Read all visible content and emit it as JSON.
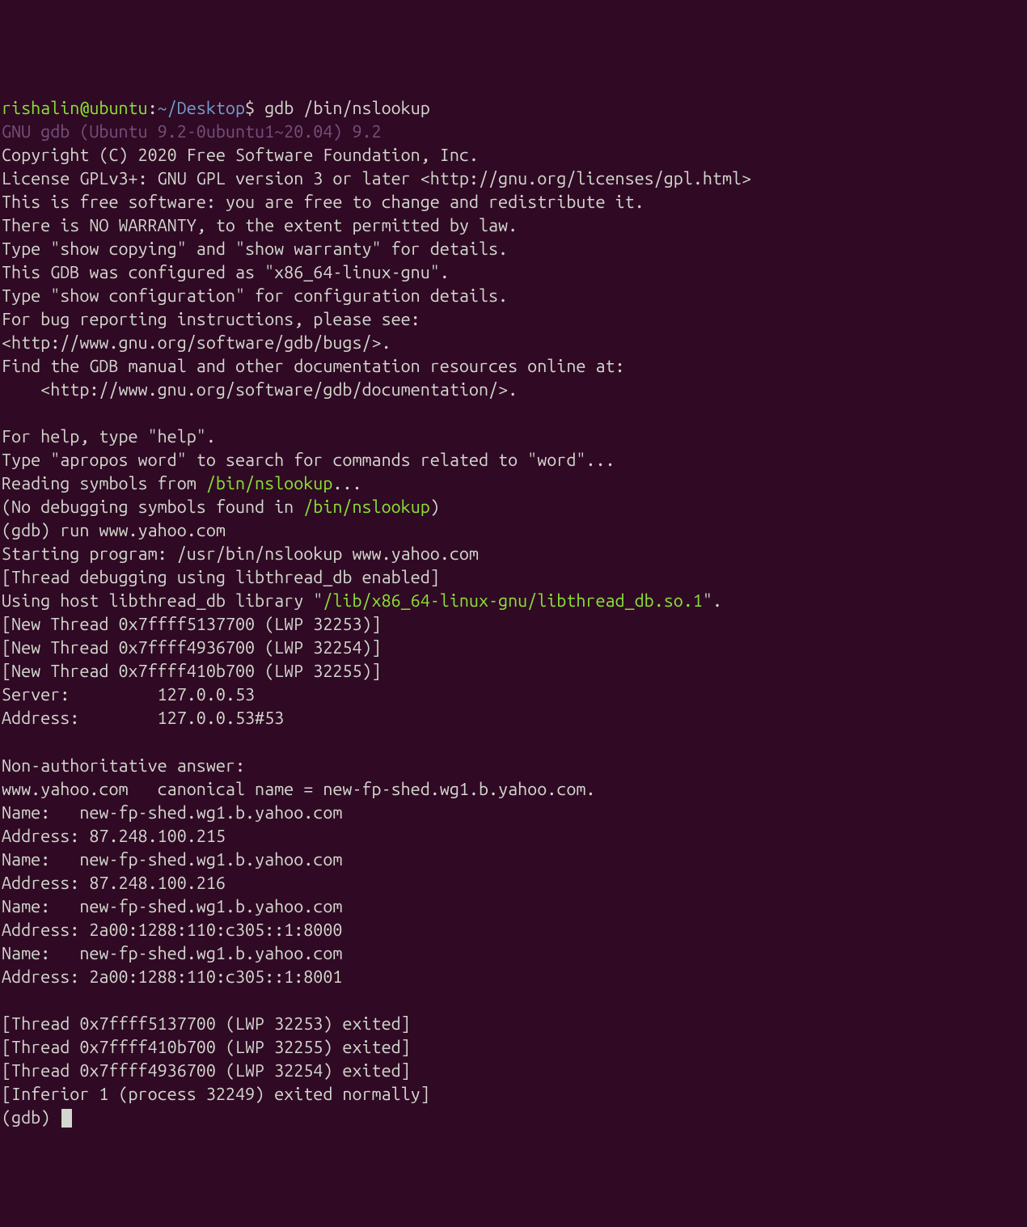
{
  "prompt": {
    "userhost": "rishalin@ubuntu",
    "colon1": ":",
    "path": "~/Desktop",
    "dollar": "$ ",
    "cmd": "gdb /bin/nslookup"
  },
  "banner": "GNU gdb (Ubuntu 9.2-0ubuntu1~20.04) 9.2",
  "lines1": [
    "Copyright (C) 2020 Free Software Foundation, Inc.",
    "License GPLv3+: GNU GPL version 3 or later <http://gnu.org/licenses/gpl.html>",
    "This is free software: you are free to change and redistribute it.",
    "There is NO WARRANTY, to the extent permitted by law.",
    "Type \"show copying\" and \"show warranty\" for details.",
    "This GDB was configured as \"x86_64-linux-gnu\".",
    "Type \"show configuration\" for configuration details.",
    "For bug reporting instructions, please see:",
    "<http://www.gnu.org/software/gdb/bugs/>.",
    "Find the GDB manual and other documentation resources online at:",
    "    <http://www.gnu.org/software/gdb/documentation/>.",
    "",
    "For help, type \"help\".",
    "Type \"apropos word\" to search for commands related to \"word\"..."
  ],
  "reading1": "Reading symbols from ",
  "reading1path": "/bin/nslookup",
  "reading1tail": "...",
  "nosym1": "(No debugging symbols found in ",
  "nosym1path": "/bin/nslookup",
  "nosym1tail": ")",
  "gdbrun": "(gdb) run www.yahoo.com",
  "lines2": [
    "Starting program: /usr/bin/nslookup www.yahoo.com",
    "[Thread debugging using libthread_db enabled]"
  ],
  "usinghost1": "Using host libthread_db library \"",
  "usinghostpath": "/lib/x86_64-linux-gnu/libthread_db.so.1",
  "usinghost2": "\".",
  "threads": [
    "[New Thread 0x7ffff5137700 (LWP 32253)]",
    "[New Thread 0x7ffff4936700 (LWP 32254)]",
    "[New Thread 0x7ffff410b700 (LWP 32255)]"
  ],
  "server": "Server:         127.0.0.53",
  "address": "Address:        127.0.0.53#53",
  "blank": "",
  "nonauth": "Non-authoritative answer:",
  "canonical": "www.yahoo.com   canonical name = new-fp-shed.wg1.b.yahoo.com.",
  "answers": [
    "Name:   new-fp-shed.wg1.b.yahoo.com",
    "Address: 87.248.100.215",
    "Name:   new-fp-shed.wg1.b.yahoo.com",
    "Address: 87.248.100.216",
    "Name:   new-fp-shed.wg1.b.yahoo.com",
    "Address: 2a00:1288:110:c305::1:8000",
    "Name:   new-fp-shed.wg1.b.yahoo.com",
    "Address: 2a00:1288:110:c305::1:8001"
  ],
  "exited": [
    "[Thread 0x7ffff5137700 (LWP 32253) exited]",
    "[Thread 0x7ffff410b700 (LWP 32255) exited]",
    "[Thread 0x7ffff4936700 (LWP 32254) exited]",
    "[Inferior 1 (process 32249) exited normally]"
  ],
  "finalprompt": "(gdb) "
}
